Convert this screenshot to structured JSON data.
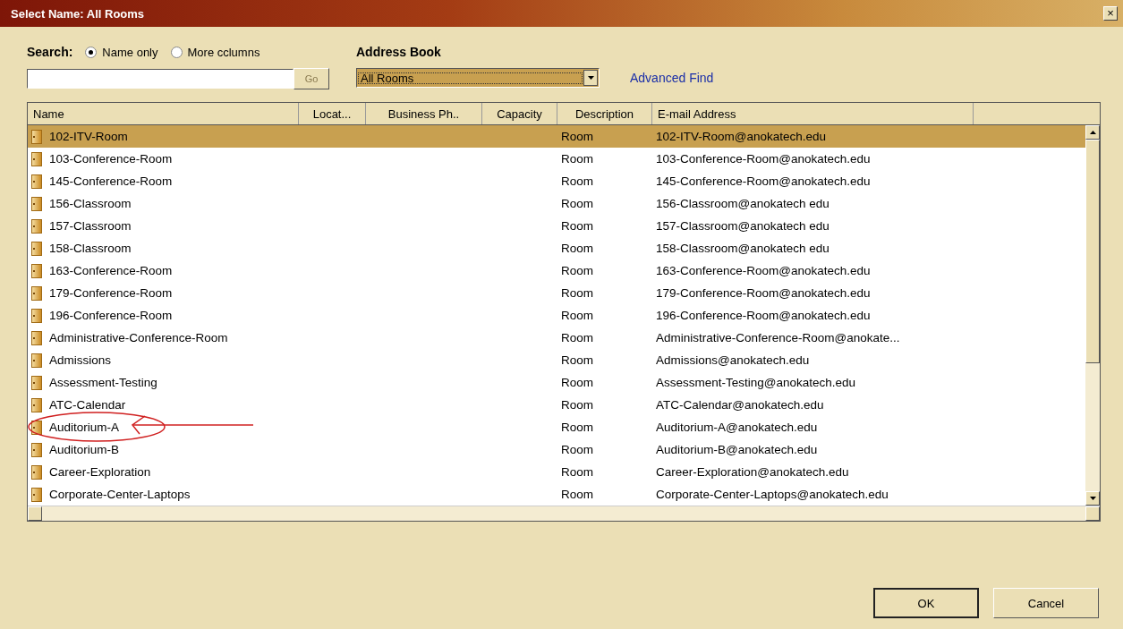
{
  "window": {
    "title": "Select Name: All Rooms",
    "close": "×"
  },
  "search": {
    "label": "Search:",
    "options": [
      {
        "label": "Name only",
        "selected": true
      },
      {
        "label": "More cclumns",
        "selected": false
      }
    ],
    "go": "Go",
    "go_disabled": true
  },
  "address_book": {
    "label": "Address Book",
    "value": "All Rooms",
    "advanced_find": "Advanced Find"
  },
  "table": {
    "columns": [
      "Name",
      "Locat...",
      "Business Ph..",
      "Capacity",
      "Description",
      "E-mail Address"
    ],
    "rows": [
      {
        "name": "102-ITV-Room",
        "description": "Room",
        "email": "102-ITV-Room@anokatech.edu",
        "selected": true
      },
      {
        "name": "103-Conference-Room",
        "description": "Room",
        "email": "103-Conference-Room@anokatech.edu",
        "selected": false
      },
      {
        "name": "145-Conference-Room",
        "description": "Room",
        "email": "145-Conference-Room@anokatech.edu",
        "selected": false
      },
      {
        "name": "156-Classroom",
        "description": "Room",
        "email": "156-Classroom@anokatech edu",
        "selected": false
      },
      {
        "name": "157-Classroom",
        "description": "Room",
        "email": "157-Classroom@anokatech edu",
        "selected": false
      },
      {
        "name": "158-Classroom",
        "description": "Room",
        "email": "158-Classroom@anokatech edu",
        "selected": false
      },
      {
        "name": "163-Conference-Room",
        "description": "Room",
        "email": "163-Conference-Room@anokatech.edu",
        "selected": false
      },
      {
        "name": "179-Conference-Room",
        "description": "Room",
        "email": "179-Conference-Room@anokatech.edu",
        "selected": false
      },
      {
        "name": "196-Conference-Room",
        "description": "Room",
        "email": "196-Conference-Room@anokatech.edu",
        "selected": false
      },
      {
        "name": "Administrative-Conference-Room",
        "description": "Room",
        "email": "Administrative-Conference-Room@anokate...",
        "selected": false
      },
      {
        "name": "Admissions",
        "description": "Room",
        "email": "Admissions@anokatech.edu",
        "selected": false
      },
      {
        "name": "Assessment-Testing",
        "description": "Room",
        "email": "Assessment-Testing@anokatech.edu",
        "selected": false
      },
      {
        "name": "ATC-Calendar",
        "description": "Room",
        "email": "ATC-Calendar@anokatech.edu",
        "selected": false
      },
      {
        "name": "Auditorium-A",
        "description": "Room",
        "email": "Auditorium-A@anokatech.edu",
        "selected": false
      },
      {
        "name": "Auditorium-B",
        "description": "Room",
        "email": "Auditorium-B@anokatech.edu",
        "selected": false
      },
      {
        "name": "Career-Exploration",
        "description": "Room",
        "email": "Career-Exploration@anokatech.edu",
        "selected": false
      },
      {
        "name": "Corporate-Center-Laptops",
        "description": "Room",
        "email": "Corporate-Center-Laptops@anokatech.edu",
        "selected": false
      }
    ]
  },
  "buttons": [
    "OK",
    "Cancel"
  ]
}
